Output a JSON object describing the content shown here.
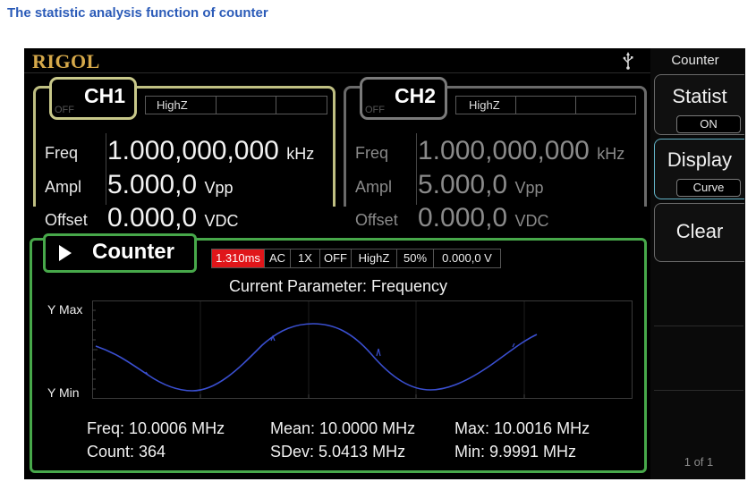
{
  "caption": "The statistic analysis function of counter",
  "brand": "RIGOL",
  "side_menu": {
    "title": "Counter",
    "statist_label": "Statist",
    "statist_value": "ON",
    "display_label": "Display",
    "display_value": "Curve",
    "clear_label": "Clear",
    "page": "1 of 1"
  },
  "ch1": {
    "off": "OFF",
    "name": "CH1",
    "impedance": "HighZ",
    "freq_label": "Freq",
    "freq_value": "1.000,000,000",
    "freq_unit": "kHz",
    "ampl_label": "Ampl",
    "ampl_value": "5.000,0",
    "ampl_unit": "Vpp",
    "offset_label": "Offset",
    "offset_value": "0.000,0",
    "offset_unit": "VDC"
  },
  "ch2": {
    "off": "OFF",
    "name": "CH2",
    "impedance": "HighZ",
    "freq_label": "Freq",
    "freq_value": "1.000,000,000",
    "freq_unit": "kHz",
    "ampl_label": "Ampl",
    "ampl_value": "5.000,0",
    "ampl_unit": "Vpp",
    "offset_label": "Offset",
    "offset_value": "0.000,0",
    "offset_unit": "VDC"
  },
  "counter": {
    "title": "Counter",
    "gate": "1.310ms",
    "coupling": "AC",
    "sensitivity": "1X",
    "hf_reject": "OFF",
    "impedance": "HighZ",
    "duty": "50%",
    "level": "0.000,0 V",
    "current_param": "Current Parameter: Frequency",
    "y_max": "Y Max",
    "y_min": "Y Min",
    "freq": "Freq: 10.0006 MHz",
    "count": "Count: 364",
    "mean": "Mean: 10.0000 MHz",
    "sdev": "SDev: 5.0413 MHz",
    "max": "Max: 10.0016 MHz",
    "min": "Min: 9.9991 MHz"
  },
  "colors": {
    "ch1_border": "#bfbf82",
    "ch2_border": "#6a6a6a",
    "counter_border": "#47a84a",
    "trace": "#3a4fd0",
    "gate_highlight": "#e0161a",
    "brand": "#d6a94a"
  }
}
